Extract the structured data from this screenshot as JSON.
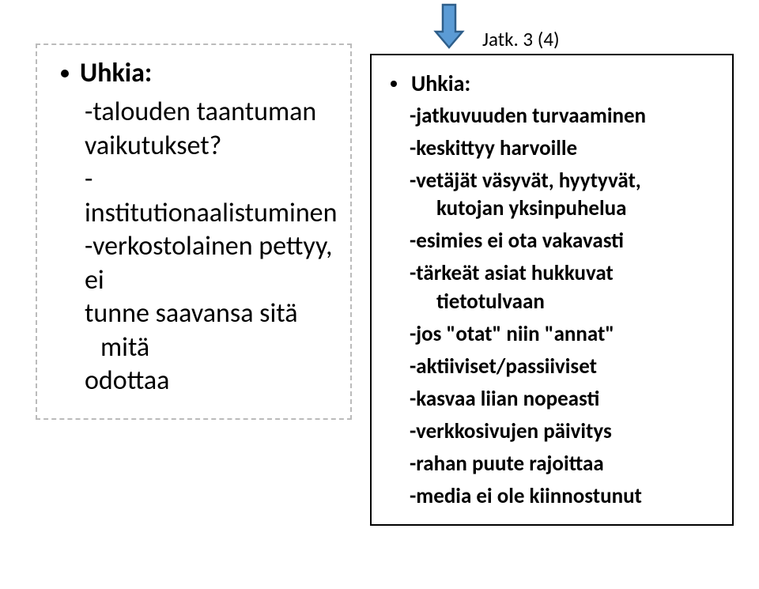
{
  "left": {
    "heading": "Uhkia:",
    "items": [
      {
        "l1": "-talouden taantuman",
        "l2": "vaikutukset?"
      },
      {
        "l1": "-institutionaalistuminen"
      },
      {
        "l1": "-verkostolainen pettyy, ei",
        "l2": "tunne saavansa sitä mitä",
        "l3": "odottaa"
      }
    ]
  },
  "top_label": "Jatk. 3 (4)",
  "right": {
    "heading": "Uhkia:",
    "items": [
      {
        "l1": "-jatkuvuuden turvaaminen"
      },
      {
        "l1": "-keskittyy harvoille"
      },
      {
        "l1": "-vetäjät väsyvät, hyytyvät,",
        "l2": "kutojan yksinpuhelua"
      },
      {
        "l1": "-esimies ei ota vakavasti"
      },
      {
        "l1": "-tärkeät asiat hukkuvat",
        "l2": "tietotulvaan"
      },
      {
        "l1": "-jos \"otat\" niin \"annat\""
      },
      {
        "l1": "-aktiiviset/passiiviset"
      },
      {
        "l1": "-kasvaa liian nopeasti"
      },
      {
        "l1": "-verkkosivujen päivitys"
      },
      {
        "l1": "-rahan puute rajoittaa"
      },
      {
        "l1": "-media ei ole kiinnostunut"
      }
    ]
  }
}
